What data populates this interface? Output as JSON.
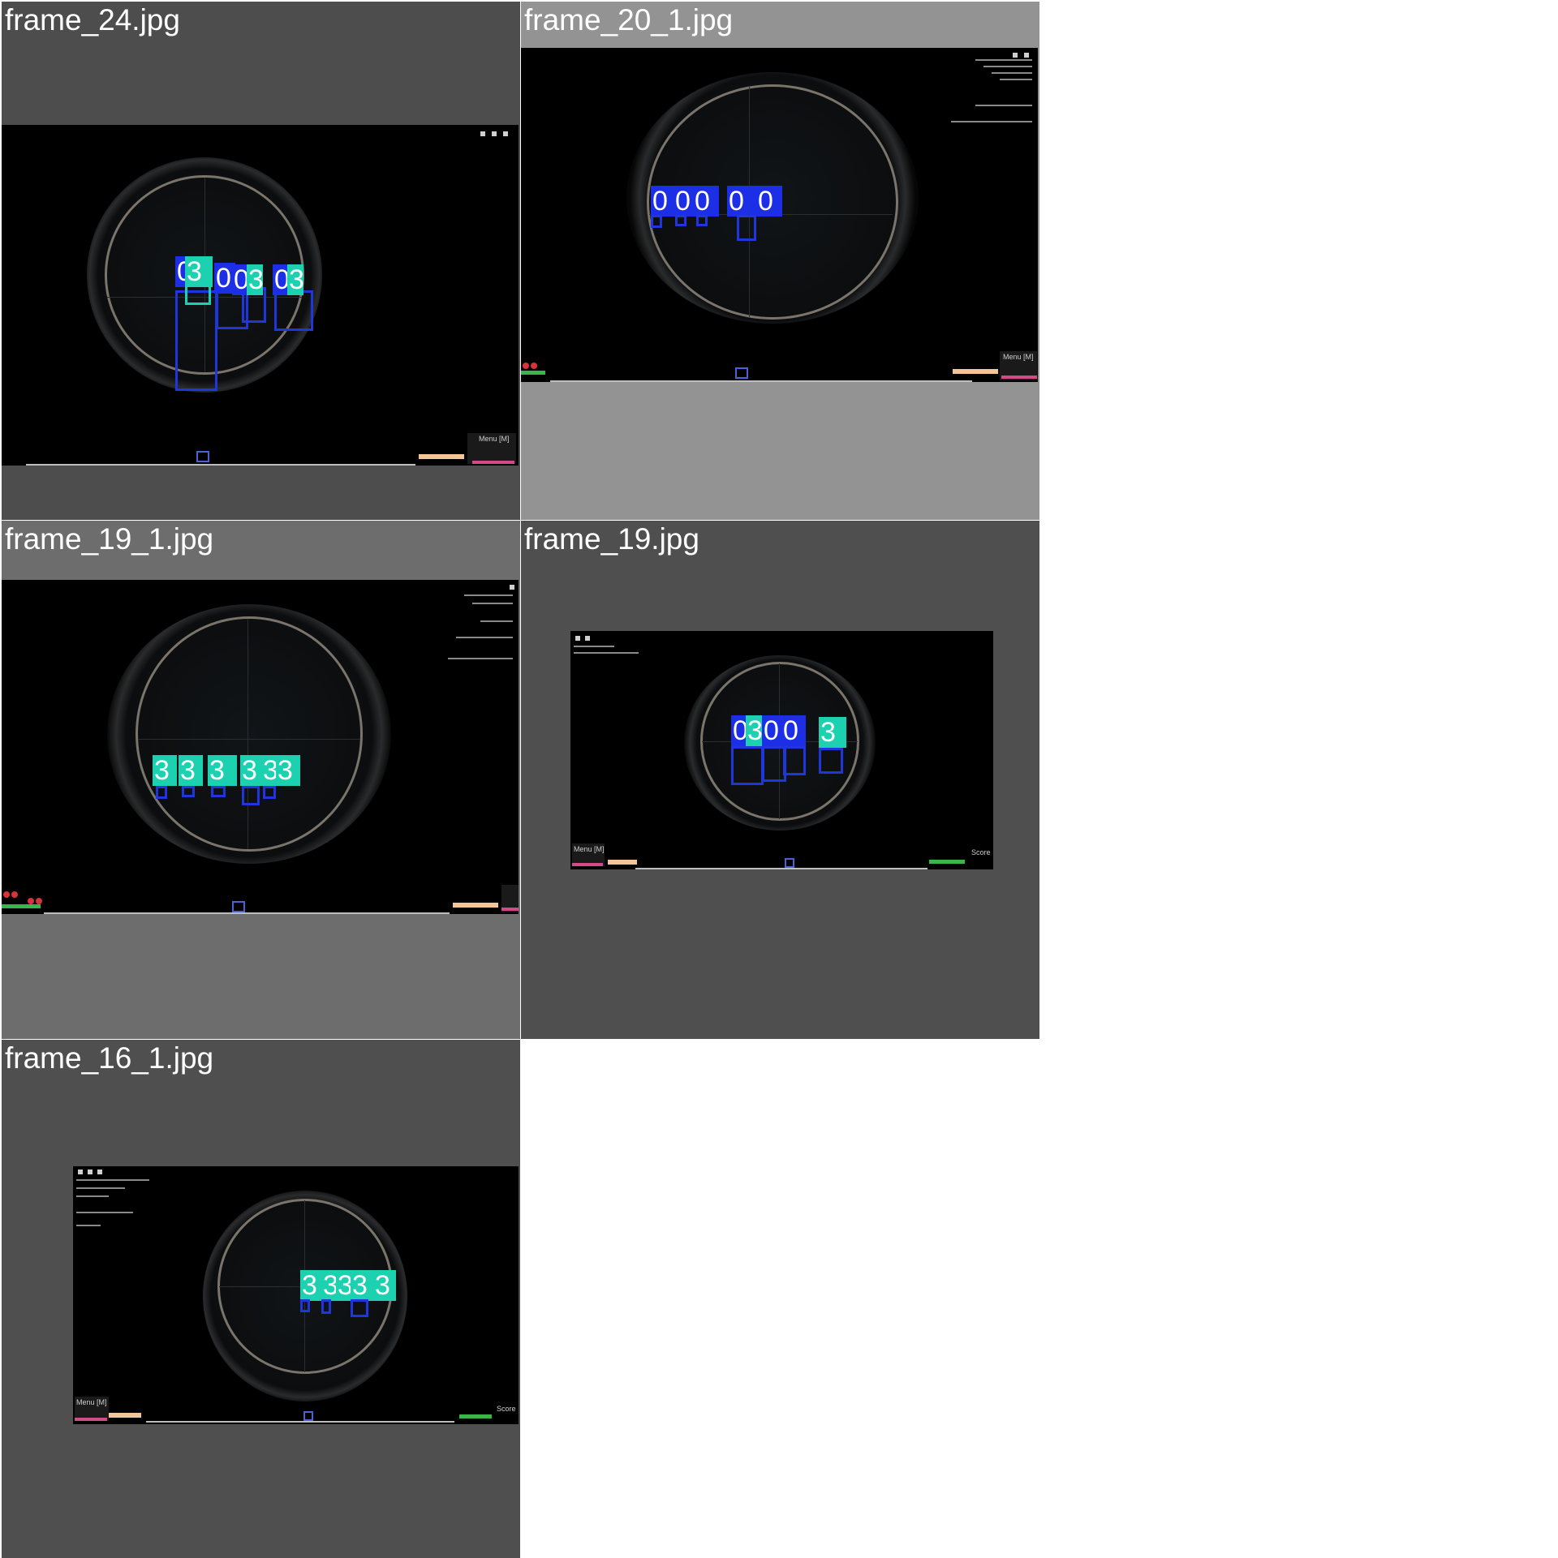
{
  "tiles": [
    {
      "title": "frame_24.jpg",
      "bg": "#4d4d4d"
    },
    {
      "title": "frame_20_1.jpg",
      "bg": "#939393"
    },
    {
      "title": "frame_19_1.jpg",
      "bg": "#6d6d6d"
    },
    {
      "title": "frame_19.jpg",
      "bg": "#4f4f4f"
    },
    {
      "title": "frame_16_1.jpg",
      "bg": "#4f4f4f"
    }
  ],
  "class_colors": {
    "0": "#1c2ee6",
    "3": "#1bd1b0"
  },
  "box_color": "#1f36dd",
  "labels": {
    "t1": [
      "0",
      "3",
      "0",
      "0",
      "3",
      "0",
      "3"
    ],
    "t2": [
      "0",
      "0",
      "0",
      "0",
      "0"
    ],
    "t3": [
      "3",
      "3",
      "3",
      "3",
      "3",
      "3"
    ],
    "t4": [
      "0",
      "3",
      "0",
      "0",
      "3"
    ],
    "t5": [
      "3",
      "3",
      "3",
      "3",
      "3"
    ]
  },
  "hud": {
    "menu_label": "Menu [M]",
    "score_label": "Score"
  }
}
